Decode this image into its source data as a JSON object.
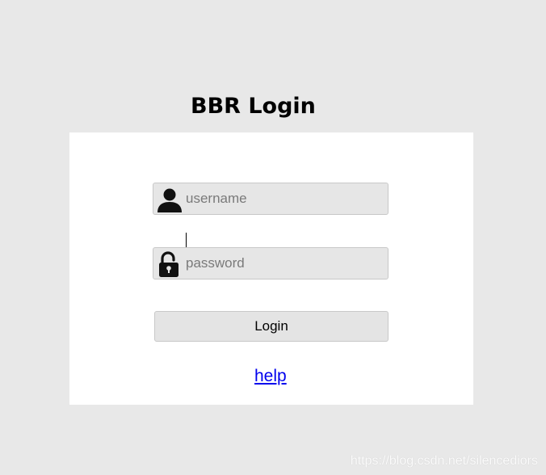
{
  "page": {
    "title": "BBR Login"
  },
  "form": {
    "username": {
      "placeholder": "username",
      "value": "",
      "icon": "user-icon"
    },
    "password": {
      "placeholder": "password",
      "value": "",
      "icon": "lock-icon"
    },
    "login_label": "Login",
    "help_label": "help"
  },
  "watermark": "https://blog.csdn.net/silencediors",
  "colors": {
    "background": "#e8e8e8",
    "panel": "#ffffff",
    "field": "#e6e6e6",
    "link": "#0000ee"
  }
}
